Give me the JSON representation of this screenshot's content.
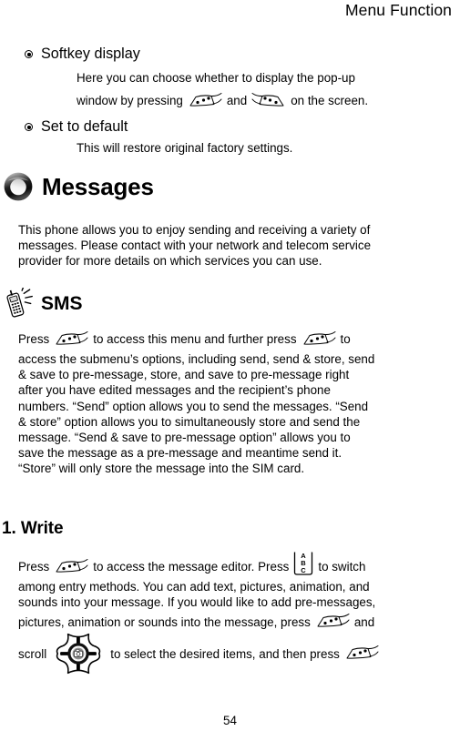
{
  "document": {
    "running_header": "Menu Function",
    "page_number": "54"
  },
  "settings_section": {
    "items": [
      {
        "bullet_label": "Softkey display",
        "description_line_1": "Here you can choose whether to display the pop-up",
        "description_line_2_part_1": "window by pressing",
        "description_line_2_part_2": "and",
        "description_line_2_part_3": "on the screen.",
        "icon_1": "softkey-left-icon",
        "icon_2": "softkey-right-icon"
      },
      {
        "bullet_label": "Set to default",
        "description_line_1": "This will restore original factory settings."
      }
    ]
  },
  "messages_section": {
    "heading": "Messages",
    "heading_icon": "messages-ring-icon",
    "intro_lines": [
      "This phone allows you to enjoy sending and receiving a variety of",
      "messages. Please contact with your network and telecom service",
      "provider for more details on which services you can use."
    ]
  },
  "sms_section": {
    "heading": "SMS",
    "heading_icon": "ringing-phone-icon",
    "line_1_part_1": "Press",
    "line_1_part_2": "to access this menu and further press",
    "line_1_part_3": "to",
    "line_1_icon_1": "softkey-left-icon",
    "line_1_icon_2": "softkey-left-icon",
    "lines": [
      "access the submenu’s options, including send, send & store, send",
      "& save to pre-message, store, and save to pre-message right",
      "after you have edited messages and the recipient’s phone",
      "numbers. “Send” option allows you to send the messages. “Send",
      "& store” option allows you to simultaneously store and send the",
      "message. “Send & save to pre-message option” allows you to",
      "save the message as a pre-message and meantime send it.",
      "“Store” will only store the message into the SIM card."
    ]
  },
  "write_section": {
    "heading": "1. Write",
    "line_1_part_1": "Press",
    "line_1_part_2": "to access the message editor. Press",
    "line_1_part_3": "to switch",
    "line_1_icon_1": "softkey-left-icon",
    "line_1_icon_2": "abc-key-icon",
    "line_2": "among entry methods. You can add text, pictures, animation, and",
    "line_3": "sounds into your message. If you would like to add pre-messages,",
    "line_4_part_1": "pictures, animation or sounds into the message, press",
    "line_4_part_2": "and",
    "line_4_icon": "softkey-left-icon",
    "line_5_part_1": "scroll",
    "line_5_part_2": "to select the desired items, and then press",
    "line_5_icon_1": "dpad-navigation-icon",
    "line_5_icon_2": "softkey-left-icon"
  },
  "colors": {
    "ink": "#000000",
    "paper": "#ffffff",
    "icon_dark": "#1a1a1a",
    "icon_mid": "#7a7a7a",
    "icon_light": "#e8e8e8"
  }
}
